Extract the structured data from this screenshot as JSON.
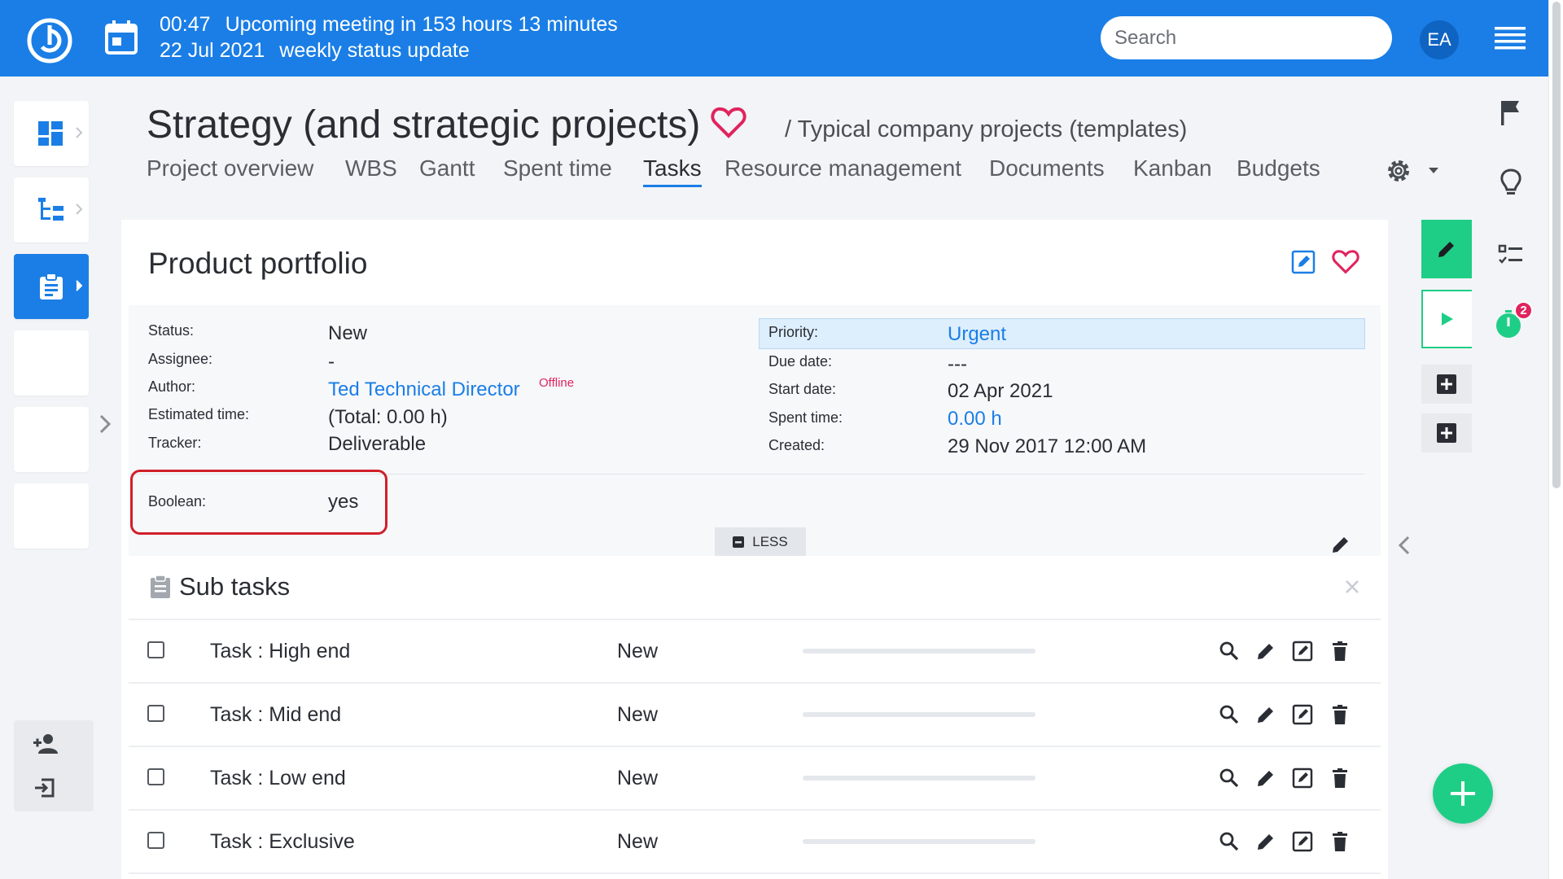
{
  "meeting": {
    "time": "00:47",
    "date": "22 Jul 2021",
    "upcoming_text": "Upcoming meeting in 153 hours 13 minutes",
    "title": "weekly status update"
  },
  "header": {
    "search_placeholder": "Search",
    "avatar_initials": "EA"
  },
  "project": {
    "title": "Strategy (and strategic projects)",
    "breadcrumb": "/ Typical company projects (templates)"
  },
  "tabs": [
    {
      "label": "Project overview",
      "active": false
    },
    {
      "label": "WBS",
      "active": false
    },
    {
      "label": "Gantt",
      "active": false
    },
    {
      "label": "Spent time",
      "active": false
    },
    {
      "label": "Tasks",
      "active": true
    },
    {
      "label": "Resource management",
      "active": false
    },
    {
      "label": "Documents",
      "active": false
    },
    {
      "label": "Kanban",
      "active": false
    },
    {
      "label": "Budgets",
      "active": false
    }
  ],
  "task": {
    "title": "Product portfolio",
    "left_attrs": [
      {
        "label": "Status:",
        "value": "New"
      },
      {
        "label": "Assignee:",
        "value": "-"
      },
      {
        "label": "Author:",
        "value": "Ted Technical Director",
        "link": true
      },
      {
        "label": "Estimated time:",
        "value": "(Total: 0.00 h)"
      },
      {
        "label": "Tracker:",
        "value": "Deliverable"
      }
    ],
    "author_presence": "Offline",
    "right_attrs": [
      {
        "label": "Priority:",
        "value": "Urgent",
        "link": true
      },
      {
        "label": "Due date:",
        "value": "---"
      },
      {
        "label": "Start date:",
        "value": "02 Apr 2021"
      },
      {
        "label": "Spent time:",
        "value": "0.00 h",
        "link": true
      },
      {
        "label": "Created:",
        "value": "29 Nov 2017 12:00 AM"
      }
    ],
    "custom_field": {
      "label": "Boolean:",
      "value": "yes"
    },
    "less_label": "LESS"
  },
  "subtasks": {
    "heading": "Sub tasks",
    "rows": [
      {
        "name": "Task : High end",
        "status": "New",
        "progress": 0
      },
      {
        "name": "Task : Mid end",
        "status": "New",
        "progress": 0
      },
      {
        "name": "Task : Low end",
        "status": "New",
        "progress": 0
      },
      {
        "name": "Task : Exclusive",
        "status": "New",
        "progress": 0
      }
    ]
  },
  "sidebar_right": {
    "timer_badge": "2"
  },
  "colors": {
    "brand": "#1a7ee6",
    "accent_green": "#1fce86",
    "heart": "#e0245e",
    "highlight": "#d0202a"
  }
}
